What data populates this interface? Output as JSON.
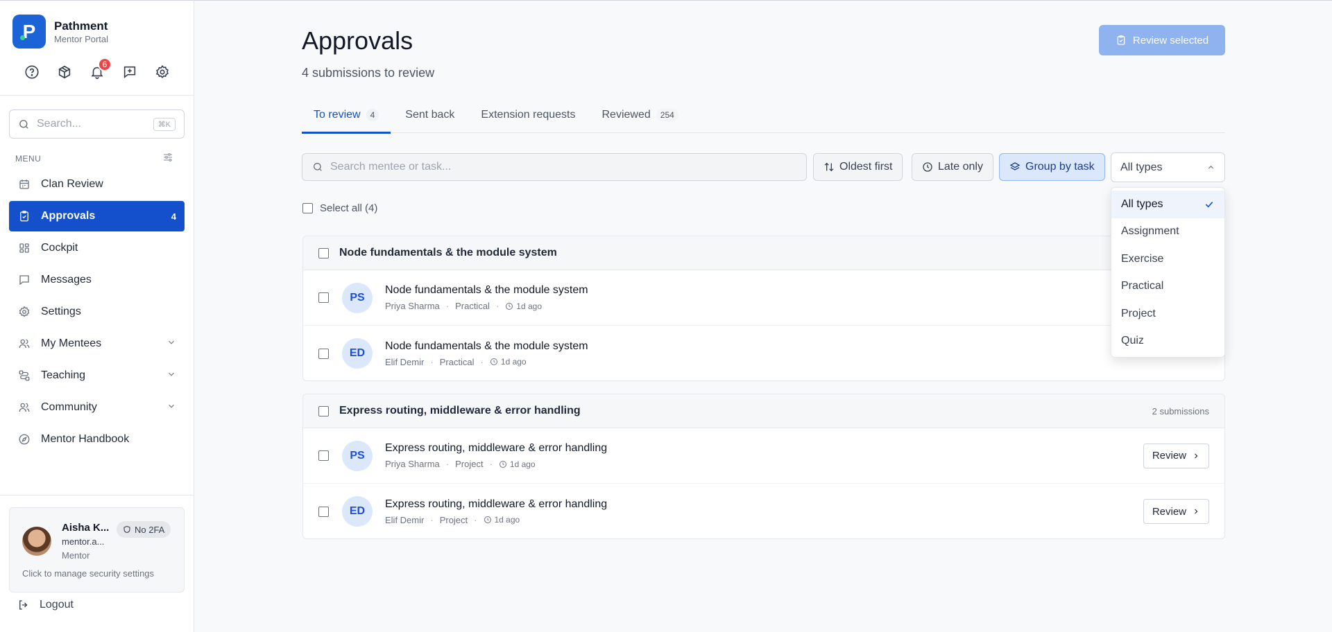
{
  "app": {
    "name": "Pathment",
    "subtitle": "Mentor Portal"
  },
  "top_icons": {
    "notifications_count": "6"
  },
  "sidebar": {
    "search_placeholder": "Search...",
    "search_shortcut": "⌘K",
    "menu_label": "MENU",
    "items": [
      {
        "label": "Clan Review",
        "icon": "calendar-icon"
      },
      {
        "label": "Approvals",
        "icon": "clipboard-check-icon",
        "count": "4",
        "active": true
      },
      {
        "label": "Cockpit",
        "icon": "dashboard-icon"
      },
      {
        "label": "Messages",
        "icon": "message-icon"
      },
      {
        "label": "Settings",
        "icon": "gear-icon"
      },
      {
        "label": "My Mentees",
        "icon": "users-icon",
        "expandable": true
      },
      {
        "label": "Teaching",
        "icon": "route-icon",
        "expandable": true
      },
      {
        "label": "Community",
        "icon": "community-icon",
        "expandable": true
      },
      {
        "label": "Mentor Handbook",
        "icon": "compass-icon"
      }
    ]
  },
  "user": {
    "name": "Aisha K...",
    "email": "mentor.a...",
    "role": "Mentor",
    "badge": "No 2FA",
    "security_hint": "Click to manage security settings"
  },
  "logout_label": "Logout",
  "page": {
    "title": "Approvals",
    "subtitle": "4 submissions to review",
    "review_selected": "Review selected"
  },
  "tabs": [
    {
      "label": "To review",
      "count": "4",
      "active": true
    },
    {
      "label": "Sent back"
    },
    {
      "label": "Extension requests"
    },
    {
      "label": "Reviewed",
      "count": "254"
    }
  ],
  "filters": {
    "search_placeholder": "Search mentee or task...",
    "sort": "Oldest first",
    "late": "Late only",
    "group": "Group by task",
    "type_value": "All types",
    "type_options": [
      "All types",
      "Assignment",
      "Exercise",
      "Practical",
      "Project",
      "Quiz"
    ],
    "selected_option": "All types"
  },
  "select_all": "Select all (4)",
  "groups": [
    {
      "title": "Node fundamentals & the module system",
      "count_label": "",
      "rows": [
        {
          "initials": "PS",
          "title": "Node fundamentals & the module system",
          "name": "Priya Sharma",
          "type": "Practical",
          "ago": "1d ago"
        },
        {
          "initials": "ED",
          "title": "Node fundamentals & the module system",
          "name": "Elif Demir",
          "type": "Practical",
          "ago": "1d ago"
        }
      ]
    },
    {
      "title": "Express routing, middleware & error handling",
      "count_label": "2 submissions",
      "rows": [
        {
          "initials": "PS",
          "title": "Express routing, middleware & error handling",
          "name": "Priya Sharma",
          "type": "Project",
          "ago": "1d ago",
          "action": "Review"
        },
        {
          "initials": "ED",
          "title": "Express routing, middleware & error handling",
          "name": "Elif Demir",
          "type": "Project",
          "ago": "1d ago",
          "action": "Review"
        }
      ]
    }
  ],
  "colors": {
    "primary": "#1450cc",
    "badge_red": "#ef4444",
    "review_selected_bg": "#8fb3ef"
  }
}
